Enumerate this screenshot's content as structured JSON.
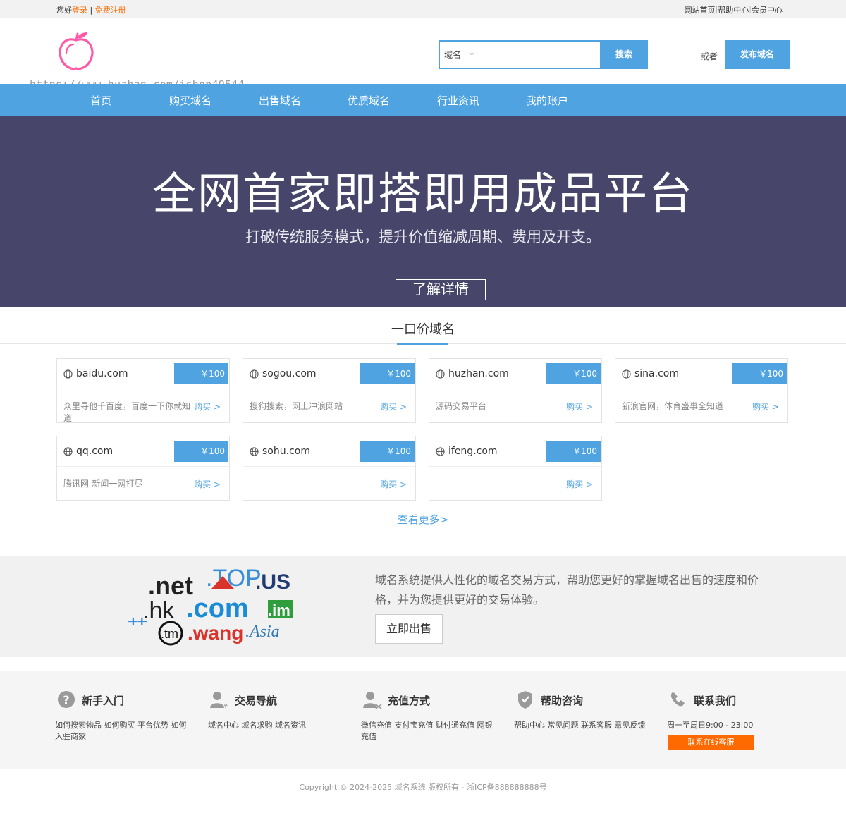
{
  "topbar": {
    "greeting": "您好",
    "login": "登录",
    "separator": "|",
    "register": "免费注册",
    "links": [
      "网站首页",
      "帮助中心",
      "会员中心"
    ]
  },
  "header": {
    "watermark": "https://www.huzhan.com/ishop49544",
    "search_type": "域名",
    "search_value": "",
    "search_button": "搜索",
    "or_text": "或者",
    "publish_button": "发布域名"
  },
  "nav": [
    "首页",
    "购买域名",
    "出售域名",
    "优质域名",
    "行业资讯",
    "我的账户"
  ],
  "banner": {
    "title": "全网首家即搭即用成品平台",
    "subtitle": "打破传统服务模式，提升价值缩减周期、费用及开支。",
    "button": "了解详情"
  },
  "section": {
    "title": "一口价域名",
    "see_more": "查看更多>"
  },
  "domains": [
    {
      "name": "baidu.com",
      "price": "￥100",
      "desc": "众里寻他千百度，百度一下你就知道",
      "buy": "购买 >"
    },
    {
      "name": "sogou.com",
      "price": "￥100",
      "desc": "搜狗搜索，网上冲浪网站",
      "buy": "购买 >"
    },
    {
      "name": "huzhan.com",
      "price": "￥100",
      "desc": "源码交易平台",
      "buy": "购买 >"
    },
    {
      "name": "sina.com",
      "price": "￥100",
      "desc": "新浪官网，体育盛事全知道",
      "buy": "购买 >"
    },
    {
      "name": "qq.com",
      "price": "￥100",
      "desc": "腾讯网-新闻一网打尽",
      "buy": "购买 >"
    },
    {
      "name": "sohu.com",
      "price": "￥100",
      "desc": "",
      "buy": "购买 >"
    },
    {
      "name": "ifeng.com",
      "price": "￥100",
      "desc": "",
      "buy": "购买 >"
    }
  ],
  "promo": {
    "logo_words": [
      ".net",
      ".TOP",
      ".US",
      ".hk",
      ".com",
      ".im",
      ".tm",
      ".wang",
      ".Asia"
    ],
    "text": "域名系统提供人性化的域名交易方式，帮助您更好的掌握域名出售的速度和价格，并为您提供更好的交易体验。",
    "button": "立即出售"
  },
  "help": [
    {
      "icon": "question-icon",
      "title": "新手入门",
      "links": [
        "如何搜索物品",
        "如何购买",
        "平台优势",
        "如何入驻商家"
      ]
    },
    {
      "icon": "trade-user-icon",
      "title": "交易导航",
      "links": [
        "域名中心",
        "域名求购",
        "域名资讯"
      ]
    },
    {
      "icon": "recharge-user-icon",
      "title": "充值方式",
      "links": [
        "微信充值",
        "支付宝充值",
        "财付通充值",
        "网银充值"
      ]
    },
    {
      "icon": "shield-icon",
      "title": "帮助咨询",
      "links": [
        "帮助中心",
        "常见问题",
        "联系客服",
        "意见反馈"
      ]
    },
    {
      "icon": "phone-icon",
      "title": "联系我们",
      "links": [
        "周一至周日9:00 - 23:00"
      ]
    }
  ],
  "service_button": "联系在线客服",
  "copyright": "Copyright © 2024-2025 域名系统 版权所有 - 浙ICP备888888888号",
  "colors": {
    "accent": "#4ea3e0",
    "banner": "#47466a",
    "orange": "#ff6a00"
  }
}
